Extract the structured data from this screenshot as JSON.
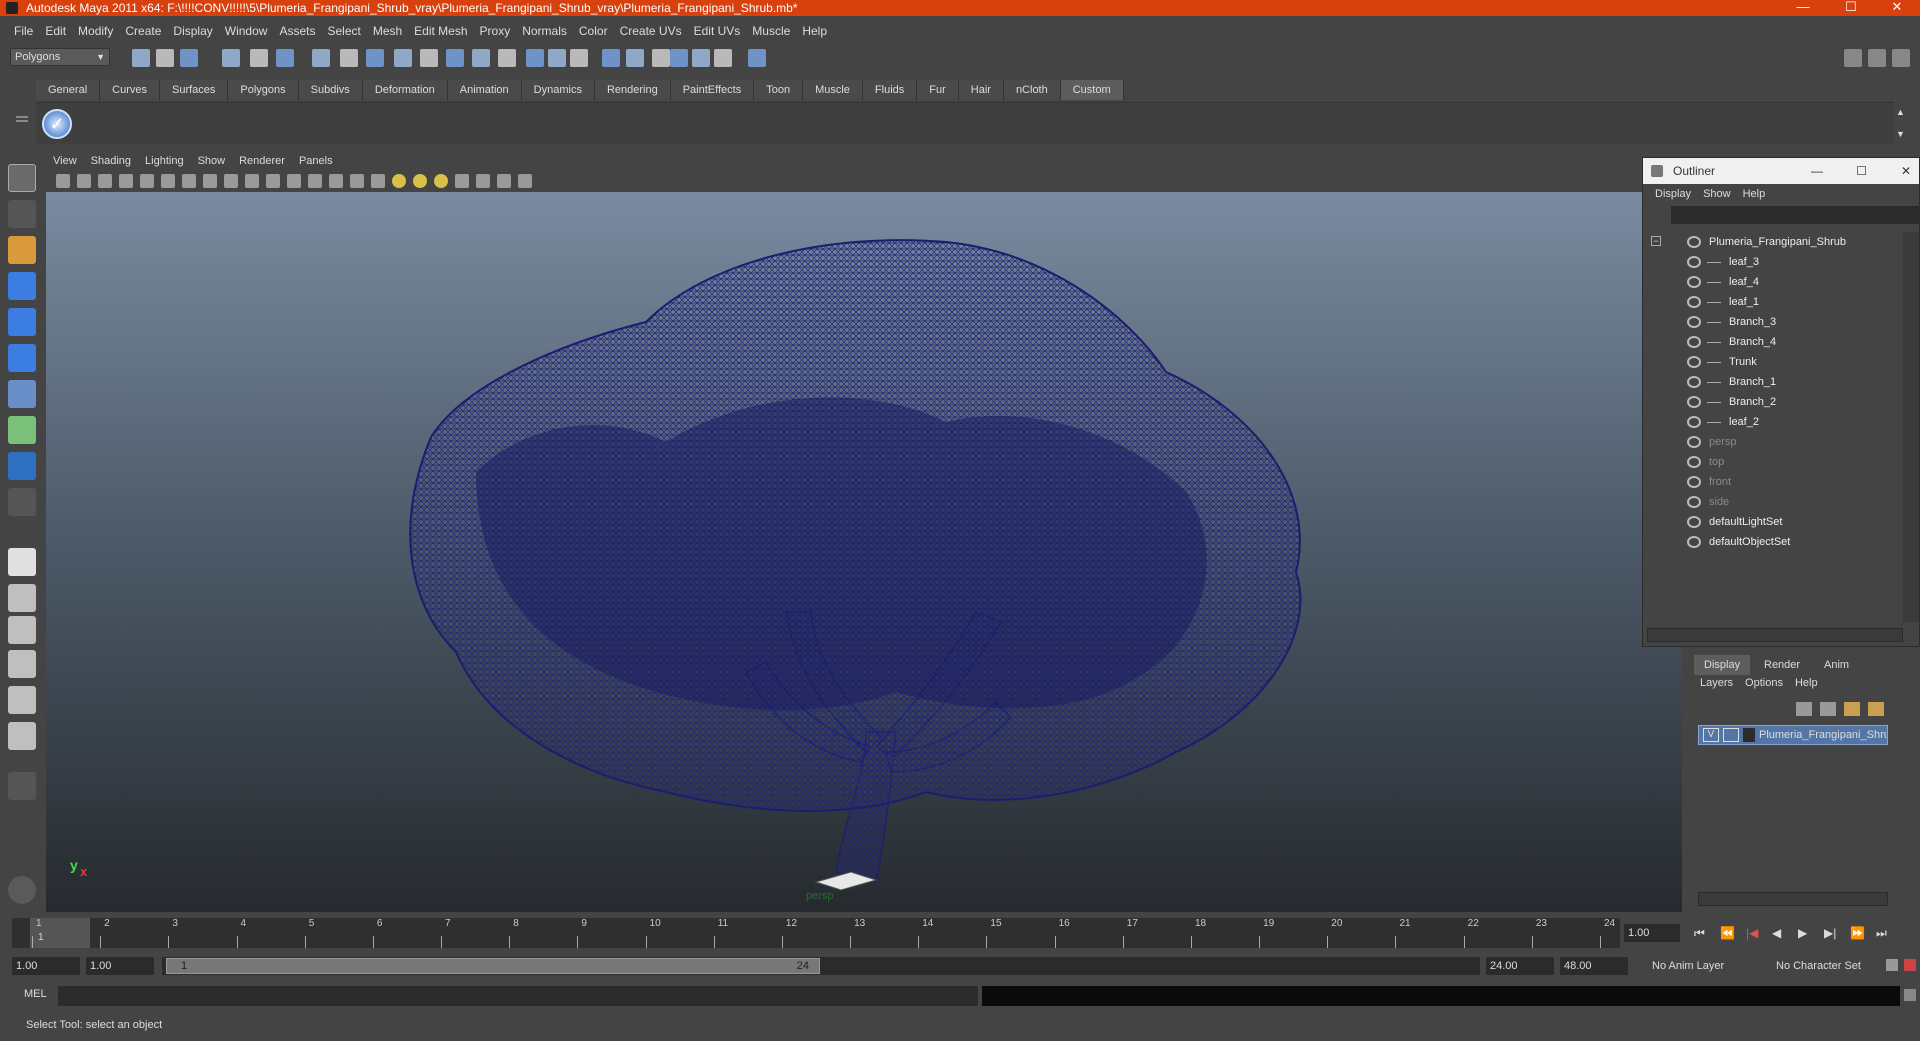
{
  "window": {
    "title": "Autodesk Maya 2011 x64: F:\\!!!!CONV!!!!!\\5\\Plumeria_Frangipani_Shrub_vray\\Plumeria_Frangipani_Shrub_vray\\Plumeria_Frangipani_Shrub.mb*",
    "minimize": "—",
    "maximize": "☐",
    "close": "✕"
  },
  "menubar": [
    "File",
    "Edit",
    "Modify",
    "Create",
    "Display",
    "Window",
    "Assets",
    "Select",
    "Mesh",
    "Edit Mesh",
    "Proxy",
    "Normals",
    "Color",
    "Create UVs",
    "Edit UVs",
    "Muscle",
    "Help"
  ],
  "mode_dropdown": "Polygons",
  "shelf_tabs": [
    {
      "label": "General",
      "active": false
    },
    {
      "label": "Curves",
      "active": false
    },
    {
      "label": "Surfaces",
      "active": false
    },
    {
      "label": "Polygons",
      "active": false
    },
    {
      "label": "Subdivs",
      "active": false
    },
    {
      "label": "Deformation",
      "active": false
    },
    {
      "label": "Animation",
      "active": false
    },
    {
      "label": "Dynamics",
      "active": false
    },
    {
      "label": "Rendering",
      "active": false
    },
    {
      "label": "PaintEffects",
      "active": false
    },
    {
      "label": "Toon",
      "active": false
    },
    {
      "label": "Muscle",
      "active": false
    },
    {
      "label": "Fluids",
      "active": false
    },
    {
      "label": "Fur",
      "active": false
    },
    {
      "label": "Hair",
      "active": false
    },
    {
      "label": "nCloth",
      "active": false
    },
    {
      "label": "Custom",
      "active": true
    }
  ],
  "viewport": {
    "menus": [
      "View",
      "Shading",
      "Lighting",
      "Show",
      "Renderer",
      "Panels"
    ],
    "camera_label": "persp",
    "axis_y": "y",
    "axis_x": "x",
    "wire_color": "#1b1d6e"
  },
  "outliner": {
    "title": "Outliner",
    "menus": [
      "Display",
      "Show",
      "Help"
    ],
    "items": [
      {
        "label": "Plumeria_Frangipani_Shrub",
        "dim": false,
        "child": false
      },
      {
        "label": "leaf_3",
        "dim": false,
        "child": true
      },
      {
        "label": "leaf_4",
        "dim": false,
        "child": true
      },
      {
        "label": "leaf_1",
        "dim": false,
        "child": true
      },
      {
        "label": "Branch_3",
        "dim": false,
        "child": true
      },
      {
        "label": "Branch_4",
        "dim": false,
        "child": true
      },
      {
        "label": "Trunk",
        "dim": false,
        "child": true
      },
      {
        "label": "Branch_1",
        "dim": false,
        "child": true
      },
      {
        "label": "Branch_2",
        "dim": false,
        "child": true
      },
      {
        "label": "leaf_2",
        "dim": false,
        "child": true
      },
      {
        "label": "persp",
        "dim": true,
        "child": false
      },
      {
        "label": "top",
        "dim": true,
        "child": false
      },
      {
        "label": "front",
        "dim": true,
        "child": false
      },
      {
        "label": "side",
        "dim": true,
        "child": false
      },
      {
        "label": "defaultLightSet",
        "dim": false,
        "child": false
      },
      {
        "label": "defaultObjectSet",
        "dim": false,
        "child": false
      }
    ]
  },
  "layer_editor": {
    "tabs": [
      "Display",
      "Render",
      "Anim"
    ],
    "menus": [
      "Layers",
      "Options",
      "Help"
    ],
    "layer_visible": "V",
    "layer_name": "Plumeria_Frangipani_Shru"
  },
  "timeline": {
    "ticks": [
      "1",
      "2",
      "3",
      "4",
      "5",
      "6",
      "7",
      "8",
      "9",
      "10",
      "11",
      "12",
      "13",
      "14",
      "15",
      "16",
      "17",
      "18",
      "19",
      "20",
      "21",
      "22",
      "23",
      "24"
    ],
    "current_frame_marker": "1",
    "current_time": "1.00"
  },
  "range": {
    "start_time": "1.00",
    "playback_start": "1.00",
    "slider_start": "1",
    "slider_end": "24",
    "playback_end": "24.00",
    "end_time": "48.00",
    "anim_layer": "No Anim Layer",
    "character_set": "No Character Set"
  },
  "command_line": {
    "label": "MEL"
  },
  "help_line": "Select Tool: select an object"
}
